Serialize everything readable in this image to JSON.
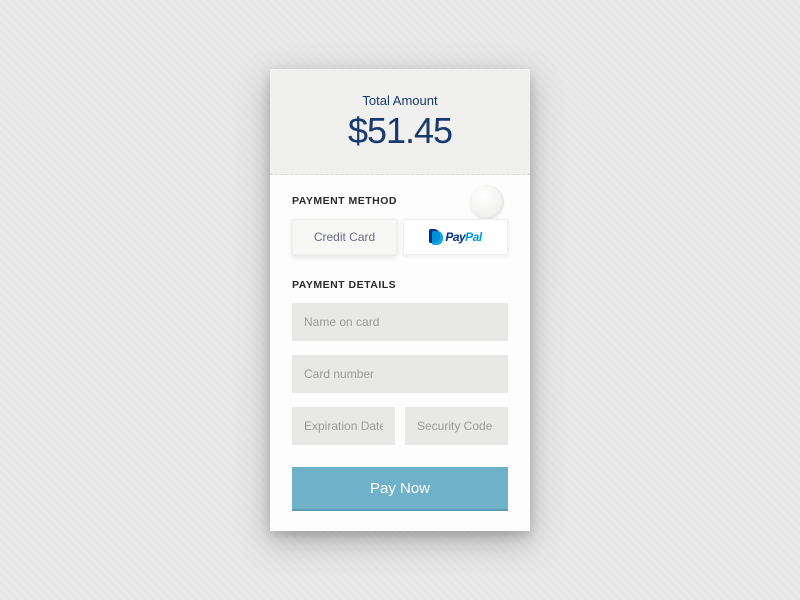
{
  "header": {
    "label": "Total Amount",
    "amount": "$51.45"
  },
  "payment_method": {
    "section_label": "PAYMENT METHOD",
    "tabs": {
      "credit_card": "Credit Card",
      "paypal_pay": "Pay",
      "paypal_pal": "Pal"
    }
  },
  "payment_details": {
    "section_label": "PAYMENT DETAILS",
    "fields": {
      "name": {
        "placeholder": "Name on card",
        "value": ""
      },
      "number": {
        "placeholder": "Card number",
        "value": ""
      },
      "expiry": {
        "placeholder": "Expiration Date",
        "value": ""
      },
      "cvv": {
        "placeholder": "Security Code",
        "value": ""
      }
    }
  },
  "submit": {
    "label": "Pay Now"
  }
}
